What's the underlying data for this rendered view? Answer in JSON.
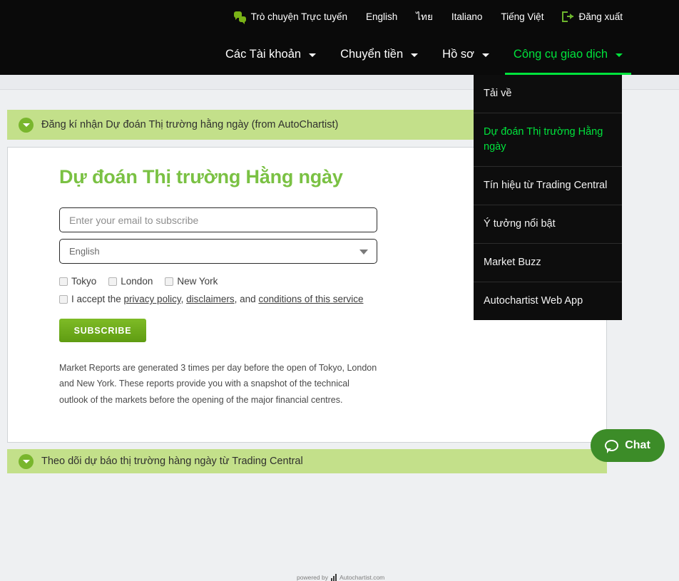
{
  "topbar": {
    "live_chat": "Trò chuyện Trực tuyến",
    "live_chat_icon": "chat-bubbles-icon",
    "languages": [
      "English",
      "ไทย",
      "Italiano",
      "Tiếng Việt"
    ],
    "logout": "Đăng xuất",
    "logout_icon": "logout-icon"
  },
  "mainnav": {
    "items": [
      {
        "label": "Các Tài khoản",
        "active": false
      },
      {
        "label": "Chuyển tiền",
        "active": false
      },
      {
        "label": "Hồ sơ",
        "active": false
      },
      {
        "label": "Công cụ giao dịch",
        "active": true
      }
    ],
    "active_color": "#00e33c"
  },
  "dropdown": {
    "items": [
      {
        "label": "Tải về",
        "active": false
      },
      {
        "label": "Dự đoán Thị trường Hằng ngày",
        "active": true
      },
      {
        "label": "Tín hiệu từ Trading Central",
        "active": false
      },
      {
        "label": "Ý tưởng nổi bật",
        "active": false
      },
      {
        "label": "Market Buzz",
        "active": false
      },
      {
        "label": "Autochartist Web App",
        "active": false
      }
    ]
  },
  "accordions": {
    "top": "Đăng kí nhận Dự đoán Thị trường hằng ngày (from AutoChartist)",
    "bottom": "Theo dõi dự báo thị trường hàng ngày từ Trading Central",
    "icon": "chevron-down-circle-icon",
    "bar_color": "#c3e08a"
  },
  "panel": {
    "title": "Dự đoán Thị trường Hằng ngày",
    "title_color": "#7ac143",
    "email": {
      "value": "",
      "placeholder": "Enter your email to subscribe"
    },
    "language_select": {
      "value": "English"
    },
    "sessions": [
      {
        "label": "Tokyo",
        "checked": false
      },
      {
        "label": "London",
        "checked": false
      },
      {
        "label": "New York",
        "checked": false
      }
    ],
    "accept": {
      "prefix": "I accept the ",
      "link1": "privacy policy",
      "sep1": ", ",
      "link2": "disclaimers",
      "sep2": ", and ",
      "link3": "conditions of this service",
      "checked": false
    },
    "subscribe_label": "SUBSCRIBE",
    "description": "Market Reports are generated 3 times per day before the open of Tokyo, London and New York. These reports provide you with a snapshot of the technical outlook of the markets before the opening of the major financial centres.",
    "powered_by": "powered by",
    "powered_brand": "Autochartist.com",
    "powered_icon": "bar-chart-logo-icon"
  },
  "chat_widget": {
    "label": "Chat",
    "icon": "speech-bubble-icon",
    "color": "#3c8c28"
  }
}
